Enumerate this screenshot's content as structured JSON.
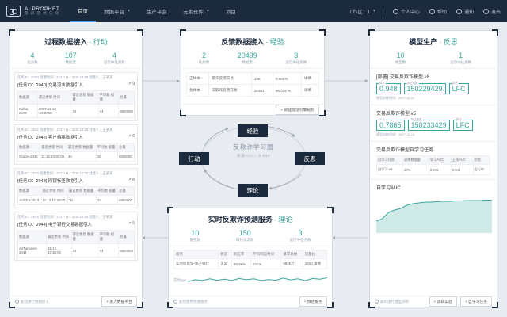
{
  "logo": {
    "main": "AI PROPHET",
    "sub": "第 四 范 式 先 知"
  },
  "nav": [
    {
      "label": "首页",
      "active": true,
      "caret": false
    },
    {
      "label": "数据平台",
      "active": false,
      "caret": true
    },
    {
      "label": "生产平台",
      "active": false,
      "caret": false
    },
    {
      "label": "元素仓库",
      "active": false,
      "caret": true
    },
    {
      "label": "项目",
      "active": false,
      "caret": false
    }
  ],
  "nav_right": {
    "workspace": "工作区：1",
    "user": "个人中心",
    "help": "帮助",
    "notify": "通知",
    "logout": "退出"
  },
  "process": {
    "title": "过程数据接入",
    "title_hl": "· 行动",
    "stats": [
      {
        "val": "4",
        "lbl": "任务数"
      },
      {
        "val": "107",
        "lbl": "数据量"
      },
      {
        "val": "4",
        "lbl": "运行中任务数"
      }
    ],
    "cards": [
      {
        "meta": "任务ID：2040  创建时间：2017-11-13 08:14:38  创建人：王某某",
        "name": "[任务ID：2040] 交易流水数据引入",
        "cnt": "↗ 9",
        "headers": [
          "数据源",
          "最近更新 时间",
          "最近更新 数据量",
          "平均数 据量",
          "总量"
        ],
        "row": [
          "Kafka-2040",
          "2017-11-13 10:30:00",
          "34",
          "34",
          "6900000"
        ]
      },
      {
        "meta": "任务ID：2042  创建时间：2017-11-13 08:14:38  创建人：王某某",
        "name": "[任务ID：2042] 客户档案数据引入",
        "cnt": "↗ 6",
        "headers": [
          "数据源",
          "最近更新 时间",
          "最近更新 数据量",
          "平均数 据量",
          "总量"
        ],
        "row": [
          "Oracle-2042",
          "11-13 10:30:00",
          "34",
          "34",
          "6900000"
        ]
      },
      {
        "meta": "任务ID：2043  创建时间：2017-11-13 08:14:38  创建人：王某某",
        "name": "[任务ID：2043] 网银标签数据引入",
        "cnt": "↗ 8",
        "headers": [
          "数据源",
          "最近更新 时间",
          "最近更新 数据量",
          "平均数 据量",
          "总量"
        ],
        "row": [
          "Jet/Ora-2043",
          "11-13 10:30:00",
          "34",
          "34",
          "6900000"
        ]
      },
      {
        "meta": "任务ID：2044  创建时间：2017-11-13 08:14:38  创建人：王某某",
        "name": "[任务ID：2044] 电子银行交易数据引入",
        "cnt": "↗ 5",
        "headers": [
          "数据源",
          "最近更新 时间",
          "最近更新 数据量",
          "平均数 据量",
          "总量"
        ],
        "row": [
          "AirTurnover-2044",
          "11-13 10:30:00",
          "34",
          "34",
          "6900000"
        ]
      }
    ],
    "foot_hint": "如何进行数据接入",
    "foot_btn": "+ 进入数据平台"
  },
  "feedback": {
    "title": "反馈数据接入",
    "title_hl": "· 经验",
    "stats": [
      {
        "val": "2",
        "lbl": "任务数"
      },
      {
        "val": "20499",
        "lbl": "数据量"
      },
      {
        "val": "3",
        "lbl": "运行中任务数"
      }
    ],
    "rows": [
      [
        "正样本",
        "欺诈反馈交易",
        "198",
        "0.965%",
        "详情"
      ],
      [
        "负样本",
        "非欺诈反馈交易",
        "20301",
        "99.035 %",
        "详情"
      ]
    ],
    "foot_btn": "+ 新建反馈引擎规则"
  },
  "cycle": {
    "center_main": "反欺诈学习圈",
    "center_sub": "新表AUC：0.946",
    "top": "经验",
    "left": "行动",
    "right": "反思",
    "bottom": "理论"
  },
  "model": {
    "title": "模型生产",
    "title_hl": "· 反思",
    "stats": [
      {
        "val": "10",
        "lbl": "模型数"
      },
      {
        "val": "1",
        "lbl": "运行中任务数"
      }
    ],
    "m1": {
      "name": "[部署] 交易反欺诈模型 v8",
      "metrics": [
        {
          "lab": "AUC",
          "val": "0.948"
        },
        {
          "lab": "特征维数",
          "val": "150229429"
        },
        {
          "lab": "算法",
          "val": "LFC"
        }
      ],
      "sub": "模型训练时间：2017-11-11"
    },
    "m2": {
      "name": "交易反欺诈模型 v5",
      "metrics": [
        {
          "lab": "AUC",
          "val": "0.7865"
        },
        {
          "lab": "特征维数",
          "val": "150233429"
        },
        {
          "lab": "算法",
          "val": "LFC"
        }
      ],
      "sub": "模型训练时间：2017-11-10"
    },
    "lt_title": "交易反欺诈模型自学习任务",
    "lt_headers": [
      "自学习任务",
      "训练数据量",
      "学习AUC",
      "上线AUC",
      "状态"
    ],
    "lt_row": [
      "自学习-v8",
      "20%",
      "0.946",
      "0.944",
      "运行中"
    ],
    "auc_title": "自学习AUC",
    "auc_series": [
      0.3,
      0.36,
      0.52,
      0.58,
      0.62,
      0.7,
      0.74,
      0.76,
      0.78,
      0.78,
      0.79,
      0.8,
      0.8,
      0.81,
      0.81,
      0.82,
      0.82,
      0.82,
      0.83,
      0.83
    ],
    "foot_hint": "如何进行模型训练",
    "foot_btn1": "+ 调研实验",
    "foot_btn2": "+ 自学习任务"
  },
  "service": {
    "title": "实时反欺诈预测服务",
    "title_hl": "· 理论",
    "stats": [
      {
        "val": "10",
        "lbl": "服务数"
      },
      {
        "val": "150",
        "lbl": "每秒请求数"
      },
      {
        "val": "3",
        "lbl": "运行中任务数"
      }
    ],
    "headers": [
      "服务",
      "状态",
      "响应率",
      "平均响应时间",
      "请求总数",
      "流量比"
    ],
    "row": [
      "实时反欺诈-电子银行",
      "正常",
      "99.98%",
      "21ms",
      "3945万",
      "2200  详情"
    ],
    "qps_label": "实时qps",
    "qps_series": [
      0.45,
      0.55,
      0.5,
      0.6,
      0.52,
      0.58,
      0.5,
      0.62,
      0.55,
      0.6,
      0.5,
      0.56,
      0.52,
      0.64,
      0.54,
      0.6,
      0.5,
      0.62,
      0.58,
      0.66
    ],
    "foot_hint": "如何使用预测服务",
    "foot_btn": "+ 预估服务"
  },
  "colors": {
    "teal": "#3aa6a0",
    "navy": "#1c2a3d",
    "blue": "#4e9df5"
  }
}
